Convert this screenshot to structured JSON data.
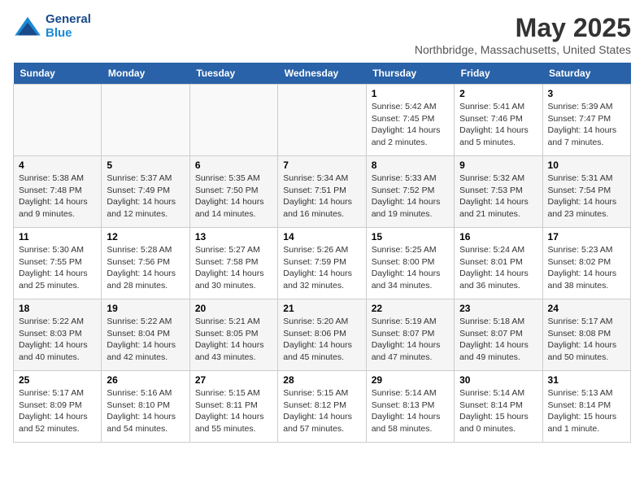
{
  "header": {
    "logo_line1": "General",
    "logo_line2": "Blue",
    "month_title": "May 2025",
    "location": "Northbridge, Massachusetts, United States"
  },
  "days_of_week": [
    "Sunday",
    "Monday",
    "Tuesday",
    "Wednesday",
    "Thursday",
    "Friday",
    "Saturday"
  ],
  "weeks": [
    [
      {
        "day": "",
        "info": ""
      },
      {
        "day": "",
        "info": ""
      },
      {
        "day": "",
        "info": ""
      },
      {
        "day": "",
        "info": ""
      },
      {
        "day": "1",
        "info": "Sunrise: 5:42 AM\nSunset: 7:45 PM\nDaylight: 14 hours\nand 2 minutes."
      },
      {
        "day": "2",
        "info": "Sunrise: 5:41 AM\nSunset: 7:46 PM\nDaylight: 14 hours\nand 5 minutes."
      },
      {
        "day": "3",
        "info": "Sunrise: 5:39 AM\nSunset: 7:47 PM\nDaylight: 14 hours\nand 7 minutes."
      }
    ],
    [
      {
        "day": "4",
        "info": "Sunrise: 5:38 AM\nSunset: 7:48 PM\nDaylight: 14 hours\nand 9 minutes."
      },
      {
        "day": "5",
        "info": "Sunrise: 5:37 AM\nSunset: 7:49 PM\nDaylight: 14 hours\nand 12 minutes."
      },
      {
        "day": "6",
        "info": "Sunrise: 5:35 AM\nSunset: 7:50 PM\nDaylight: 14 hours\nand 14 minutes."
      },
      {
        "day": "7",
        "info": "Sunrise: 5:34 AM\nSunset: 7:51 PM\nDaylight: 14 hours\nand 16 minutes."
      },
      {
        "day": "8",
        "info": "Sunrise: 5:33 AM\nSunset: 7:52 PM\nDaylight: 14 hours\nand 19 minutes."
      },
      {
        "day": "9",
        "info": "Sunrise: 5:32 AM\nSunset: 7:53 PM\nDaylight: 14 hours\nand 21 minutes."
      },
      {
        "day": "10",
        "info": "Sunrise: 5:31 AM\nSunset: 7:54 PM\nDaylight: 14 hours\nand 23 minutes."
      }
    ],
    [
      {
        "day": "11",
        "info": "Sunrise: 5:30 AM\nSunset: 7:55 PM\nDaylight: 14 hours\nand 25 minutes."
      },
      {
        "day": "12",
        "info": "Sunrise: 5:28 AM\nSunset: 7:56 PM\nDaylight: 14 hours\nand 28 minutes."
      },
      {
        "day": "13",
        "info": "Sunrise: 5:27 AM\nSunset: 7:58 PM\nDaylight: 14 hours\nand 30 minutes."
      },
      {
        "day": "14",
        "info": "Sunrise: 5:26 AM\nSunset: 7:59 PM\nDaylight: 14 hours\nand 32 minutes."
      },
      {
        "day": "15",
        "info": "Sunrise: 5:25 AM\nSunset: 8:00 PM\nDaylight: 14 hours\nand 34 minutes."
      },
      {
        "day": "16",
        "info": "Sunrise: 5:24 AM\nSunset: 8:01 PM\nDaylight: 14 hours\nand 36 minutes."
      },
      {
        "day": "17",
        "info": "Sunrise: 5:23 AM\nSunset: 8:02 PM\nDaylight: 14 hours\nand 38 minutes."
      }
    ],
    [
      {
        "day": "18",
        "info": "Sunrise: 5:22 AM\nSunset: 8:03 PM\nDaylight: 14 hours\nand 40 minutes."
      },
      {
        "day": "19",
        "info": "Sunrise: 5:22 AM\nSunset: 8:04 PM\nDaylight: 14 hours\nand 42 minutes."
      },
      {
        "day": "20",
        "info": "Sunrise: 5:21 AM\nSunset: 8:05 PM\nDaylight: 14 hours\nand 43 minutes."
      },
      {
        "day": "21",
        "info": "Sunrise: 5:20 AM\nSunset: 8:06 PM\nDaylight: 14 hours\nand 45 minutes."
      },
      {
        "day": "22",
        "info": "Sunrise: 5:19 AM\nSunset: 8:07 PM\nDaylight: 14 hours\nand 47 minutes."
      },
      {
        "day": "23",
        "info": "Sunrise: 5:18 AM\nSunset: 8:07 PM\nDaylight: 14 hours\nand 49 minutes."
      },
      {
        "day": "24",
        "info": "Sunrise: 5:17 AM\nSunset: 8:08 PM\nDaylight: 14 hours\nand 50 minutes."
      }
    ],
    [
      {
        "day": "25",
        "info": "Sunrise: 5:17 AM\nSunset: 8:09 PM\nDaylight: 14 hours\nand 52 minutes."
      },
      {
        "day": "26",
        "info": "Sunrise: 5:16 AM\nSunset: 8:10 PM\nDaylight: 14 hours\nand 54 minutes."
      },
      {
        "day": "27",
        "info": "Sunrise: 5:15 AM\nSunset: 8:11 PM\nDaylight: 14 hours\nand 55 minutes."
      },
      {
        "day": "28",
        "info": "Sunrise: 5:15 AM\nSunset: 8:12 PM\nDaylight: 14 hours\nand 57 minutes."
      },
      {
        "day": "29",
        "info": "Sunrise: 5:14 AM\nSunset: 8:13 PM\nDaylight: 14 hours\nand 58 minutes."
      },
      {
        "day": "30",
        "info": "Sunrise: 5:14 AM\nSunset: 8:14 PM\nDaylight: 15 hours\nand 0 minutes."
      },
      {
        "day": "31",
        "info": "Sunrise: 5:13 AM\nSunset: 8:14 PM\nDaylight: 15 hours\nand 1 minute."
      }
    ]
  ]
}
